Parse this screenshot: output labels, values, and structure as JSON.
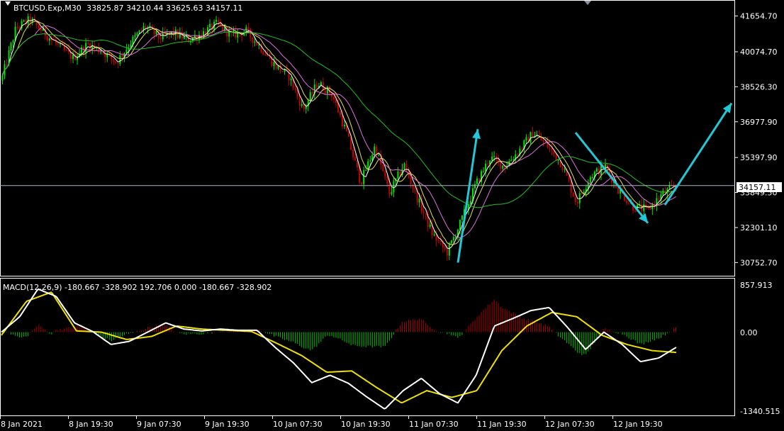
{
  "header": {
    "symbol_tf": "BTCUSD.Exp,M30",
    "ohlc": "33825.87 34210.44 33625.63 34157.11"
  },
  "macd_header": "MACD(12,26,9) -180.667 -328.902 192.706 0.000 -180.667 -328.902",
  "price_axis": [
    "41654.70",
    "40074.70",
    "38526.30",
    "36977.90",
    "35397.90",
    "33849.50",
    "32301.10",
    "30752.70"
  ],
  "current_price": "34157.11",
  "macd_axis": [
    "857.913",
    "0.00",
    "-1340.515"
  ],
  "time_axis": [
    "8 Jan 2021",
    "8 Jan 19:30",
    "9 Jan 07:30",
    "9 Jan 19:30",
    "10 Jan 07:30",
    "10 Jan 19:30",
    "11 Jan 07:30",
    "11 Jan 19:30",
    "12 Jan 07:30",
    "12 Jan 19:30"
  ],
  "colors": {
    "bull": "#00e400",
    "bear": "#c80000",
    "arrow": "#22c8d8",
    "ma_white": "#ffffff",
    "ma_yellow": "#e0e060",
    "ma_pink": "#e070e0",
    "ma_green": "#20c020",
    "macd_line": "#ffffff",
    "signal_line": "#f0e000"
  },
  "chart_data": [
    {
      "type": "candlestick",
      "title": "BTCUSD.Exp,M30",
      "y_range": [
        30200,
        42300
      ],
      "close_path": [
        {
          "x": "8 Jan 2021",
          "y": 38800
        },
        {
          "x": "",
          "y": 41100
        },
        {
          "x": "",
          "y": 41500
        },
        {
          "x": "",
          "y": 40900
        },
        {
          "x": "",
          "y": 40300
        },
        {
          "x": "8 Jan 19:30",
          "y": 39800
        },
        {
          "x": "",
          "y": 40400
        },
        {
          "x": "",
          "y": 40100
        },
        {
          "x": "",
          "y": 39600
        },
        {
          "x": "9 Jan 07:30",
          "y": 40500
        },
        {
          "x": "",
          "y": 41200
        },
        {
          "x": "",
          "y": 40700
        },
        {
          "x": "",
          "y": 40900
        },
        {
          "x": "9 Jan 19:30",
          "y": 40600
        },
        {
          "x": "",
          "y": 40900
        },
        {
          "x": "",
          "y": 41300
        },
        {
          "x": "",
          "y": 40800
        },
        {
          "x": "",
          "y": 41000
        },
        {
          "x": "10 Jan 07:30",
          "y": 40300
        },
        {
          "x": "",
          "y": 39500
        },
        {
          "x": "",
          "y": 39000
        },
        {
          "x": "",
          "y": 37500
        },
        {
          "x": "",
          "y": 38700
        },
        {
          "x": "10 Jan 19:30",
          "y": 38200
        },
        {
          "x": "",
          "y": 36500
        },
        {
          "x": "",
          "y": 34300
        },
        {
          "x": "",
          "y": 35900
        },
        {
          "x": "",
          "y": 33800
        },
        {
          "x": "",
          "y": 35100
        },
        {
          "x": "11 Jan 07:30",
          "y": 33500
        },
        {
          "x": "",
          "y": 32000
        },
        {
          "x": "",
          "y": 31200
        },
        {
          "x": "",
          "y": 32600
        },
        {
          "x": "11 Jan 19:30",
          "y": 34200
        },
        {
          "x": "",
          "y": 35400
        },
        {
          "x": "",
          "y": 35000
        },
        {
          "x": "",
          "y": 35700
        },
        {
          "x": "",
          "y": 36500
        },
        {
          "x": "12 Jan 07:30",
          "y": 35900
        },
        {
          "x": "",
          "y": 35100
        },
        {
          "x": "",
          "y": 33400
        },
        {
          "x": "",
          "y": 34600
        },
        {
          "x": "",
          "y": 35000
        },
        {
          "x": "12 Jan 19:30",
          "y": 33900
        },
        {
          "x": "",
          "y": 33200
        },
        {
          "x": "",
          "y": 33100
        },
        {
          "x": "",
          "y": 33800
        },
        {
          "x": "",
          "y": 34157
        }
      ],
      "moving_averages": [
        {
          "name": "",
          "color": "#ffffff",
          "period": 4
        },
        {
          "name": "",
          "color": "#e0e060",
          "period": 8
        },
        {
          "name": "",
          "color": "#e070e0",
          "period": 16
        },
        {
          "name": "",
          "color": "#20c020",
          "period": 44
        }
      ],
      "arrows": [
        {
          "from": {
            "x": "11 Jan 07:30",
            "y": 30750
          },
          "to": {
            "x": "11 Jan 19:30",
            "y": 36650
          }
        },
        {
          "from": {
            "x": "12 Jan 07:30",
            "y": 36500
          },
          "to": {
            "x": "12 Jan 19:30",
            "y": 32500
          }
        },
        {
          "from": {
            "x": "12 Jan 19:30",
            "y": 33300
          },
          "to": {
            "x": "",
            "y": 37800
          }
        }
      ],
      "current_price": 34157.11
    },
    {
      "type": "macd",
      "title": "MACD(12,26,9)",
      "y_range": [
        -1340.515,
        857.913
      ],
      "macd": [
        {
          "x": "8 Jan 2021",
          "y": 0
        },
        {
          "x": "",
          "y": 250
        },
        {
          "x": "",
          "y": 700
        },
        {
          "x": "",
          "y": 580
        },
        {
          "x": "",
          "y": 150
        },
        {
          "x": "8 Jan 19:30",
          "y": 10
        },
        {
          "x": "",
          "y": -200
        },
        {
          "x": "",
          "y": -150
        },
        {
          "x": "9 Jan 07:30",
          "y": 0
        },
        {
          "x": "",
          "y": 150
        },
        {
          "x": "",
          "y": 50
        },
        {
          "x": "9 Jan 19:30",
          "y": 20
        },
        {
          "x": "",
          "y": 50
        },
        {
          "x": "",
          "y": 30
        },
        {
          "x": "10 Jan 07:30",
          "y": 30
        },
        {
          "x": "",
          "y": -250
        },
        {
          "x": "",
          "y": -500
        },
        {
          "x": "",
          "y": -820
        },
        {
          "x": "10 Jan 19:30",
          "y": -700
        },
        {
          "x": "",
          "y": -830
        },
        {
          "x": "",
          "y": -1050
        },
        {
          "x": "",
          "y": -1250
        },
        {
          "x": "11 Jan 07:30",
          "y": -950
        },
        {
          "x": "",
          "y": -750
        },
        {
          "x": "",
          "y": -1000
        },
        {
          "x": "",
          "y": -1150
        },
        {
          "x": "11 Jan 19:30",
          "y": -700
        },
        {
          "x": "",
          "y": 100
        },
        {
          "x": "",
          "y": 220
        },
        {
          "x": "",
          "y": 350
        },
        {
          "x": "12 Jan 07:30",
          "y": 400
        },
        {
          "x": "",
          "y": 80
        },
        {
          "x": "",
          "y": -280
        },
        {
          "x": "",
          "y": 0
        },
        {
          "x": "12 Jan 19:30",
          "y": -200
        },
        {
          "x": "",
          "y": -480
        },
        {
          "x": "",
          "y": -420
        },
        {
          "x": "",
          "y": -240
        }
      ],
      "signal": [
        {
          "x": "8 Jan 2021",
          "y": -50
        },
        {
          "x": "",
          "y": 500
        },
        {
          "x": "",
          "y": 650
        },
        {
          "x": "8 Jan 19:30",
          "y": 20
        },
        {
          "x": "",
          "y": 0
        },
        {
          "x": "",
          "y": -120
        },
        {
          "x": "9 Jan 07:30",
          "y": -70
        },
        {
          "x": "",
          "y": 100
        },
        {
          "x": "9 Jan 19:30",
          "y": 50
        },
        {
          "x": "",
          "y": 30
        },
        {
          "x": "10 Jan 07:30",
          "y": 10
        },
        {
          "x": "",
          "y": -180
        },
        {
          "x": "",
          "y": -380
        },
        {
          "x": "10 Jan 19:30",
          "y": -650
        },
        {
          "x": "",
          "y": -630
        },
        {
          "x": "",
          "y": -900
        },
        {
          "x": "11 Jan 07:30",
          "y": -1150
        },
        {
          "x": "",
          "y": -950
        },
        {
          "x": "",
          "y": -1060
        },
        {
          "x": "11 Jan 19:30",
          "y": -950
        },
        {
          "x": "",
          "y": -300
        },
        {
          "x": "",
          "y": 100
        },
        {
          "x": "12 Jan 07:30",
          "y": 320
        },
        {
          "x": "",
          "y": 250
        },
        {
          "x": "",
          "y": -50
        },
        {
          "x": "12 Jan 19:30",
          "y": -200
        },
        {
          "x": "",
          "y": -300
        },
        {
          "x": "",
          "y": -330
        }
      ],
      "histogram_peaks": [
        {
          "x": "8 Jan 2021",
          "y": 180
        },
        {
          "x": "8 Jan 19:30",
          "y": -200
        },
        {
          "x": "9 Jan 07:30",
          "y": 180
        },
        {
          "x": "10 Jan 07:30",
          "y": -170
        },
        {
          "x": "10 Jan 19:30",
          "y": 130
        },
        {
          "x": "",
          "y": -200
        },
        {
          "x": "11 Jan 07:30",
          "y": 300
        },
        {
          "x": "",
          "y": -270
        },
        {
          "x": "11 Jan 19:30",
          "y": 630
        },
        {
          "x": "12 Jan 07:30",
          "y": 130
        },
        {
          "x": "",
          "y": -250
        },
        {
          "x": "12 Jan 19:30",
          "y": 100
        }
      ]
    }
  ]
}
